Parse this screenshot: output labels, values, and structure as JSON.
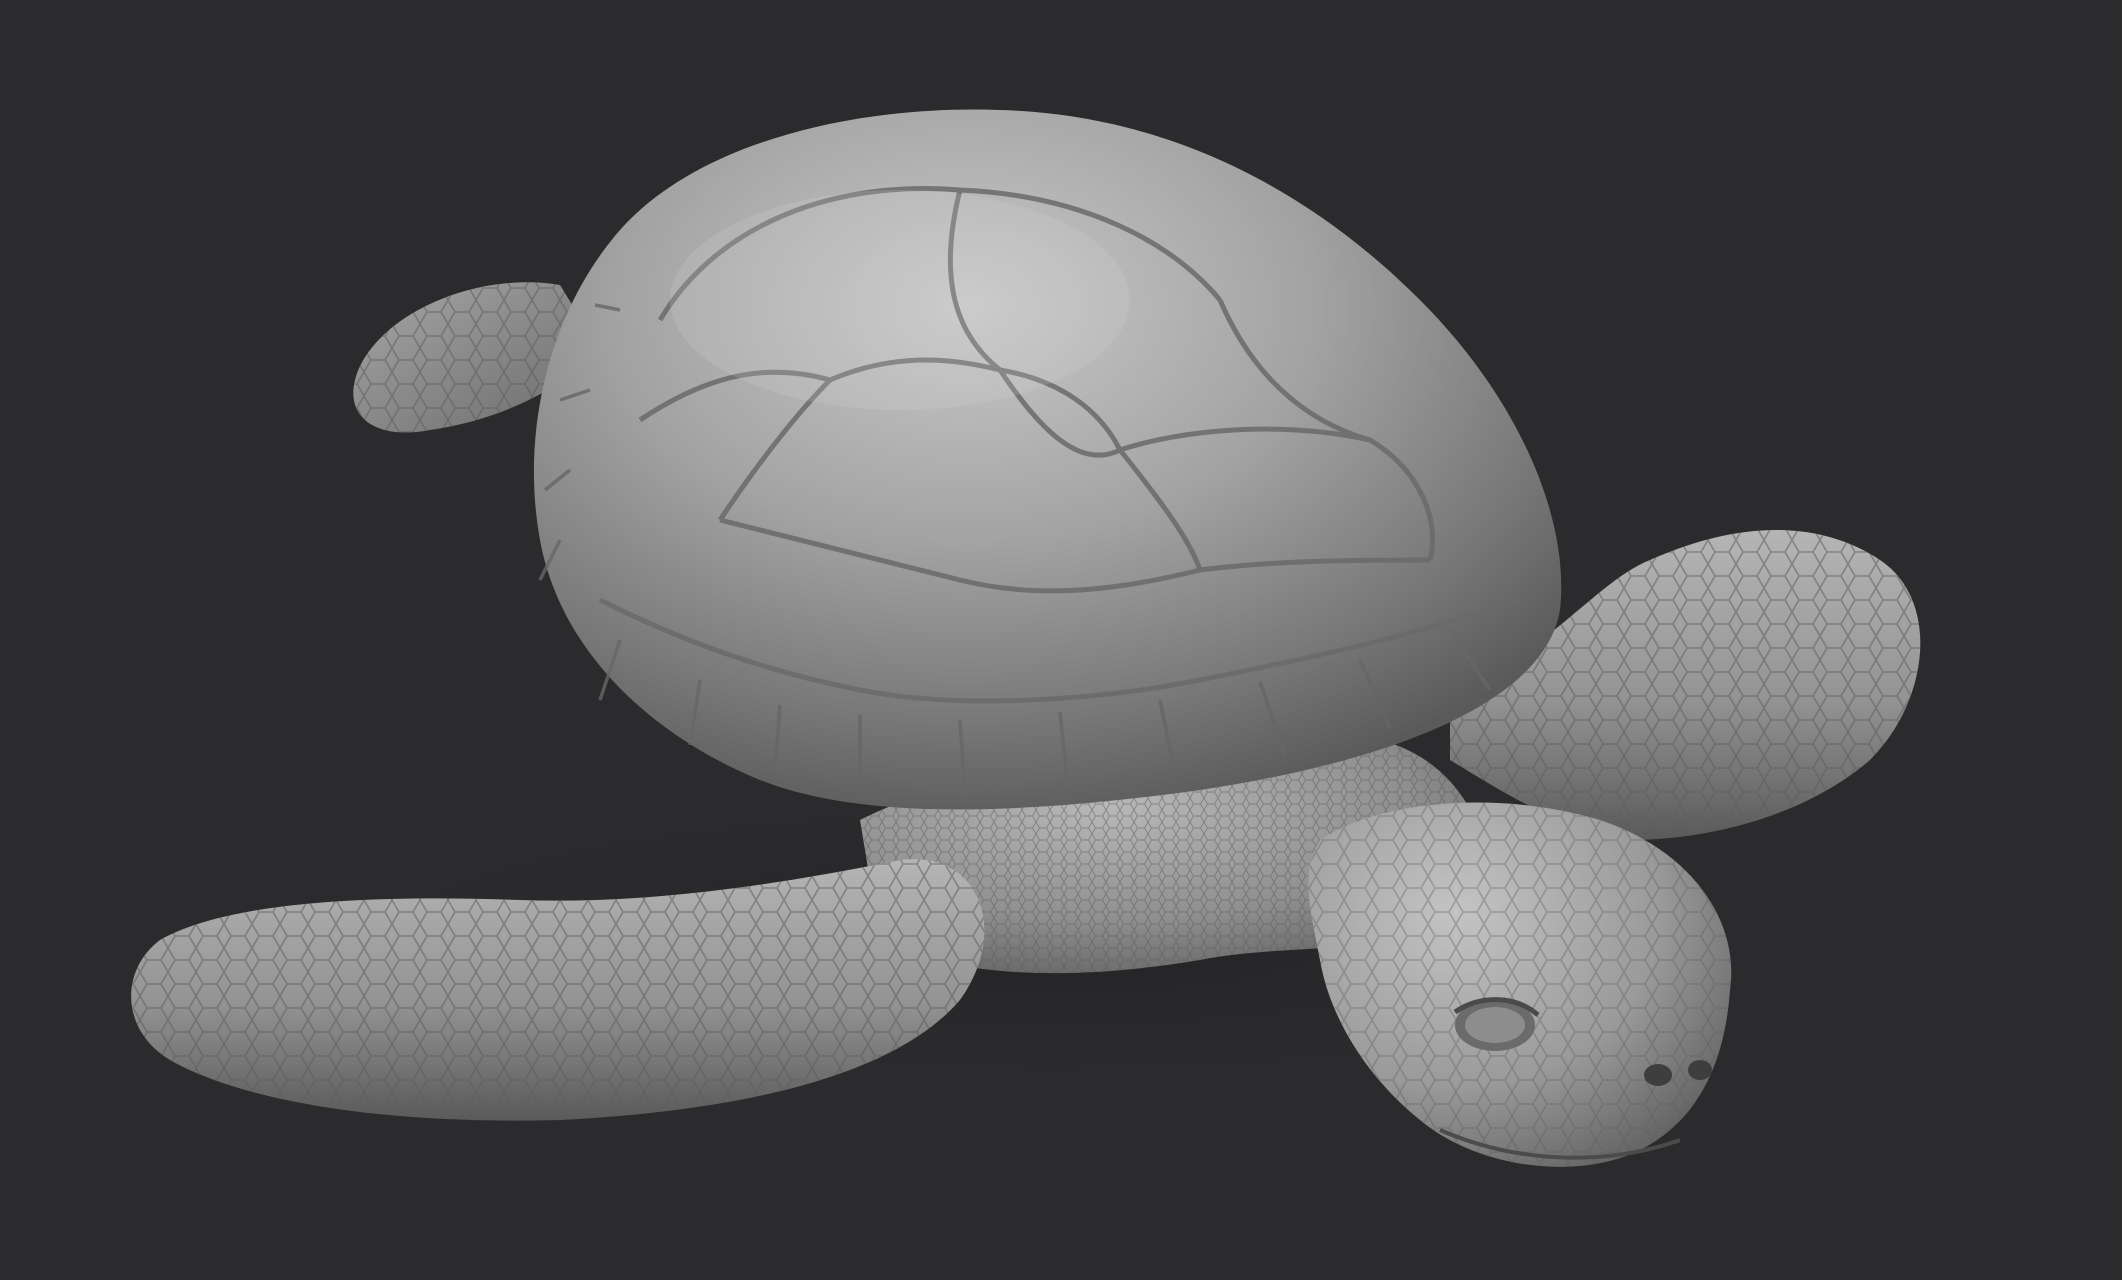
{
  "scene": {
    "subject": "sea-turtle-sculpt",
    "background_color": "#2b2b2d",
    "material_base_color": "#8e8e8e",
    "material_highlight_color": "#cfcfcf",
    "material_shadow_color": "#3a3a3a"
  }
}
